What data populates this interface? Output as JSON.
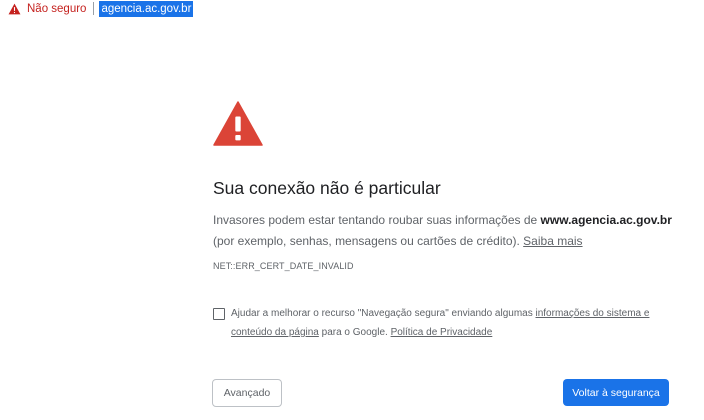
{
  "omnibox": {
    "security_label": "Não seguro",
    "url": "agencia.ac.gov.br"
  },
  "interstitial": {
    "title": "Sua conexão não é particular",
    "desc_part1": "Invasores podem estar tentando roubar suas informações de ",
    "domain": "www.agencia.ac.gov.br",
    "desc_part2": " (por exemplo, senhas, mensagens ou cartões de crédito). ",
    "learn_more": "Saiba mais",
    "error_code": "NET::ERR_CERT_DATE_INVALID",
    "safe_browsing": {
      "text1": "Ajudar a melhorar o recurso \"Navegação segura\" enviando algumas ",
      "link1": "informações do sistema e conteúdo da página",
      "text2": " para o Google. ",
      "link2": "Política de Privacidade",
      "checked": false
    },
    "advanced_button": "Avançado",
    "back_button": "Voltar à segurança"
  },
  "colors": {
    "warning_red": "#db4437",
    "not_secure_red": "#c5221f",
    "primary_blue": "#1a73e8"
  },
  "icons": {
    "omnibox": "warning-triangle-icon",
    "main": "warning-triangle-icon"
  }
}
